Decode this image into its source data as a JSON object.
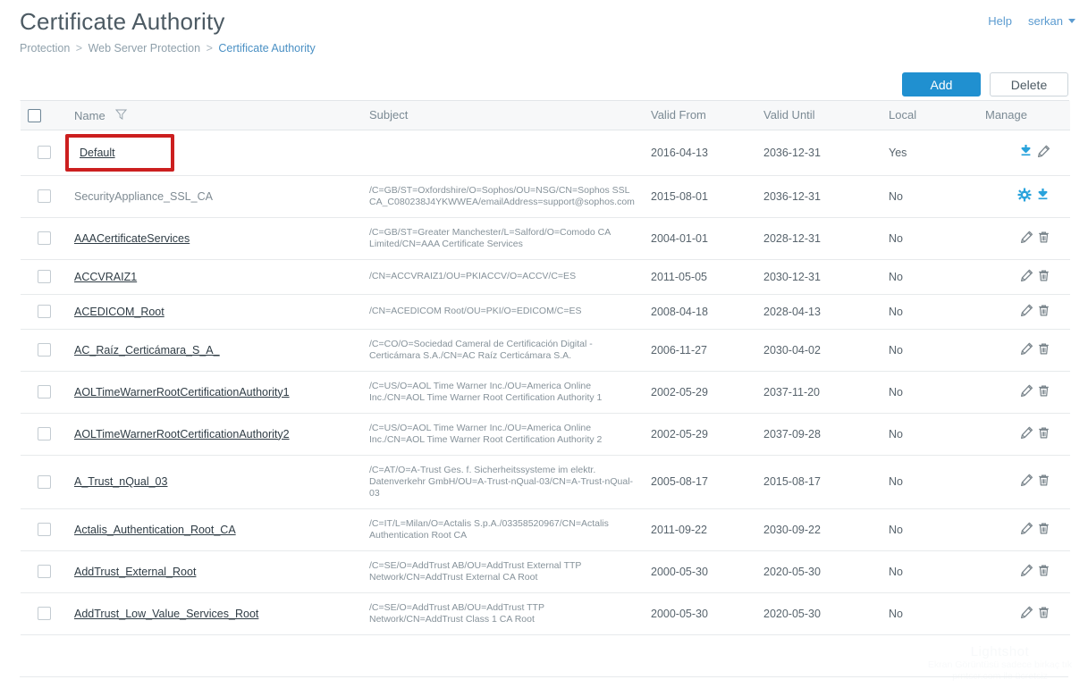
{
  "header": {
    "title": "Certificate Authority",
    "breadcrumb": [
      {
        "label": "Protection",
        "current": false
      },
      {
        "label": "Web Server Protection",
        "current": false
      },
      {
        "label": "Certificate Authority",
        "current": true
      }
    ],
    "separator": ">",
    "help_label": "Help",
    "user_label": "serkan"
  },
  "toolbar": {
    "add_label": "Add",
    "delete_label": "Delete"
  },
  "table": {
    "columns": {
      "select": "",
      "name": "Name",
      "subject": "Subject",
      "valid_from": "Valid From",
      "valid_until": "Valid Until",
      "local": "Local",
      "manage": "Manage"
    },
    "rows": [
      {
        "name": "Default",
        "is_link": true,
        "highlighted": true,
        "subject": "",
        "valid_from": "2016-04-13",
        "valid_until": "2036-12-31",
        "local": "Yes",
        "actions": [
          "download-icon",
          "edit-icon"
        ]
      },
      {
        "name": "SecurityAppliance_SSL_CA",
        "is_link": false,
        "highlighted": false,
        "subject": "/C=GB/ST=Oxfordshire/O=Sophos/OU=NSG/CN=Sophos SSL CA_C080238J4YKWWEA/emailAddress=support@sophos.com",
        "valid_from": "2015-08-01",
        "valid_until": "2036-12-31",
        "local": "No",
        "actions": [
          "gear-icon",
          "download-icon"
        ]
      },
      {
        "name": "AAACertificateServices",
        "is_link": true,
        "highlighted": false,
        "subject": "/C=GB/ST=Greater Manchester/L=Salford/O=Comodo CA Limited/CN=AAA Certificate Services",
        "valid_from": "2004-01-01",
        "valid_until": "2028-12-31",
        "local": "No",
        "actions": [
          "edit-icon",
          "delete-icon"
        ]
      },
      {
        "name": "ACCVRAIZ1",
        "is_link": true,
        "highlighted": false,
        "subject": "/CN=ACCVRAIZ1/OU=PKIACCV/O=ACCV/C=ES",
        "valid_from": "2011-05-05",
        "valid_until": "2030-12-31",
        "local": "No",
        "actions": [
          "edit-icon",
          "delete-icon"
        ]
      },
      {
        "name": "ACEDICOM_Root",
        "is_link": true,
        "highlighted": false,
        "subject": "/CN=ACEDICOM Root/OU=PKI/O=EDICOM/C=ES",
        "valid_from": "2008-04-18",
        "valid_until": "2028-04-13",
        "local": "No",
        "actions": [
          "edit-icon",
          "delete-icon"
        ]
      },
      {
        "name": "AC_Raíz_Certicámara_S_A_",
        "is_link": true,
        "highlighted": false,
        "subject": "/C=CO/O=Sociedad Cameral de Certificación Digital - Certicámara S.A./CN=AC Raíz Certicámara S.A.",
        "valid_from": "2006-11-27",
        "valid_until": "2030-04-02",
        "local": "No",
        "actions": [
          "edit-icon",
          "delete-icon"
        ]
      },
      {
        "name": "AOLTimeWarnerRootCertificationAuthority1",
        "is_link": true,
        "highlighted": false,
        "subject": "/C=US/O=AOL Time Warner Inc./OU=America Online Inc./CN=AOL Time Warner Root Certification Authority 1",
        "valid_from": "2002-05-29",
        "valid_until": "2037-11-20",
        "local": "No",
        "actions": [
          "edit-icon",
          "delete-icon"
        ]
      },
      {
        "name": "AOLTimeWarnerRootCertificationAuthority2",
        "is_link": true,
        "highlighted": false,
        "subject": "/C=US/O=AOL Time Warner Inc./OU=America Online Inc./CN=AOL Time Warner Root Certification Authority 2",
        "valid_from": "2002-05-29",
        "valid_until": "2037-09-28",
        "local": "No",
        "actions": [
          "edit-icon",
          "delete-icon"
        ]
      },
      {
        "name": "A_Trust_nQual_03",
        "is_link": true,
        "highlighted": false,
        "subject": "/C=AT/O=A-Trust Ges. f. Sicherheitssysteme im elektr. Datenverkehr GmbH/OU=A-Trust-nQual-03/CN=A-Trust-nQual-03",
        "valid_from": "2005-08-17",
        "valid_until": "2015-08-17",
        "local": "No",
        "actions": [
          "edit-icon",
          "delete-icon"
        ]
      },
      {
        "name": "Actalis_Authentication_Root_CA",
        "is_link": true,
        "highlighted": false,
        "subject": "/C=IT/L=Milan/O=Actalis S.p.A./03358520967/CN=Actalis Authentication Root CA",
        "valid_from": "2011-09-22",
        "valid_until": "2030-09-22",
        "local": "No",
        "actions": [
          "edit-icon",
          "delete-icon"
        ]
      },
      {
        "name": "AddTrust_External_Root",
        "is_link": true,
        "highlighted": false,
        "subject": "/C=SE/O=AddTrust AB/OU=AddTrust External TTP Network/CN=AddTrust External CA Root",
        "valid_from": "2000-05-30",
        "valid_until": "2020-05-30",
        "local": "No",
        "actions": [
          "edit-icon",
          "delete-icon"
        ]
      },
      {
        "name": "AddTrust_Low_Value_Services_Root",
        "is_link": true,
        "highlighted": false,
        "subject": "/C=SE/O=AddTrust AB/OU=AddTrust TTP Network/CN=AddTrust Class 1 CA Root",
        "valid_from": "2000-05-30",
        "valid_until": "2020-05-30",
        "local": "No",
        "actions": [
          "edit-icon",
          "delete-icon"
        ]
      }
    ]
  },
  "watermark": {
    "title": "Lightshot",
    "line1": "Ekran Görüntüsü sadece birkaç tık",
    "line2": "prntscr.com ile ücretsiz"
  },
  "colors": {
    "accent": "#2090d0",
    "link": "#5b9bd0",
    "highlight": "#cc1f1f",
    "icon_blue": "#29a3dc",
    "icon_gray": "#7a858c"
  }
}
